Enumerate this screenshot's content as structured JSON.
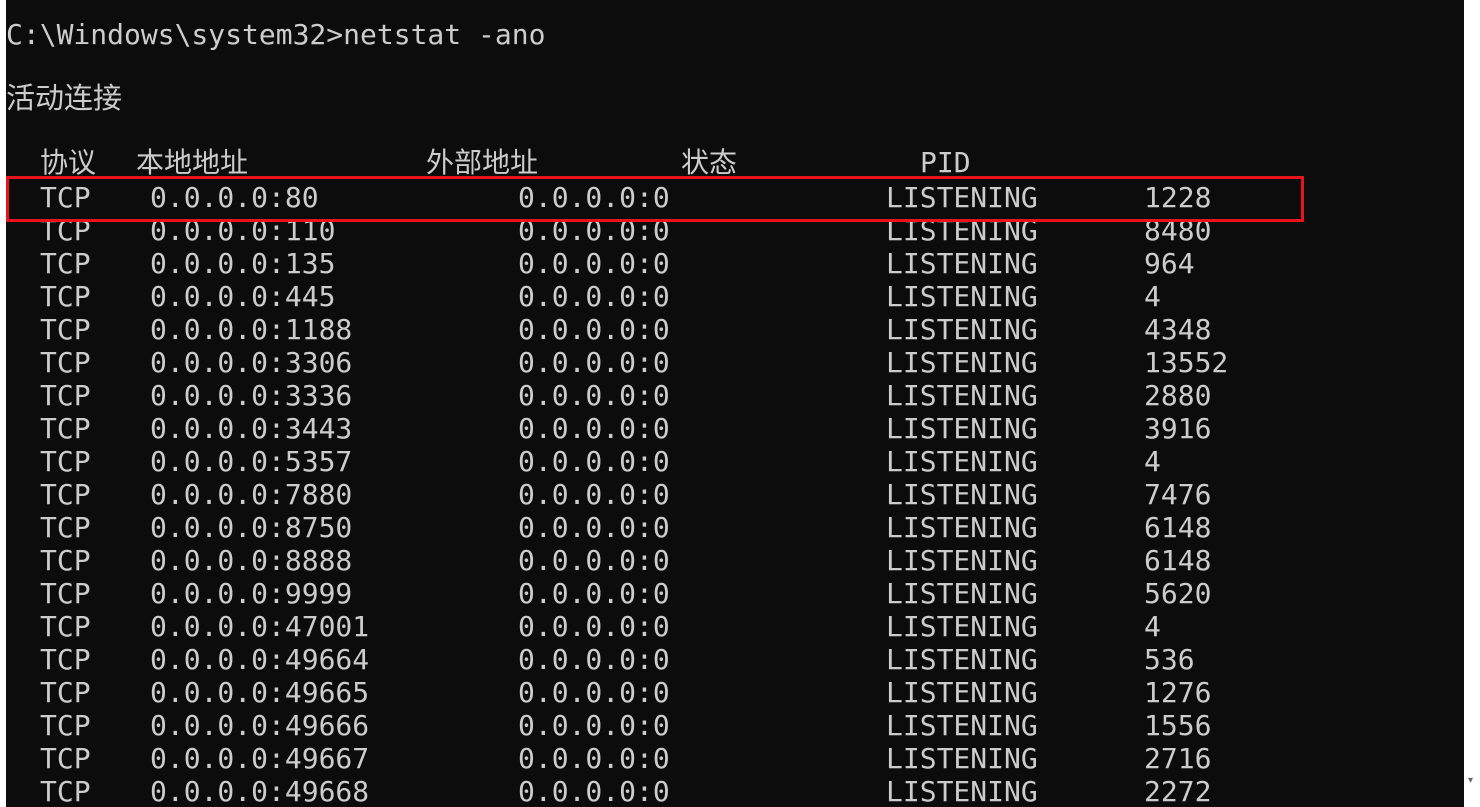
{
  "prompt": {
    "text": "C:\\Windows\\system32>netstat -ano"
  },
  "section_title": "活动连接",
  "table": {
    "headers": {
      "proto": "协议",
      "local": "本地地址",
      "foreign": "外部地址",
      "state": "状态",
      "pid": "PID"
    },
    "rows": [
      {
        "proto": "TCP",
        "local": "0.0.0.0:80",
        "foreign": "0.0.0.0:0",
        "state": "LISTENING",
        "pid": "1228"
      },
      {
        "proto": "TCP",
        "local": "0.0.0.0:110",
        "foreign": "0.0.0.0:0",
        "state": "LISTENING",
        "pid": "8480"
      },
      {
        "proto": "TCP",
        "local": "0.0.0.0:135",
        "foreign": "0.0.0.0:0",
        "state": "LISTENING",
        "pid": "964"
      },
      {
        "proto": "TCP",
        "local": "0.0.0.0:445",
        "foreign": "0.0.0.0:0",
        "state": "LISTENING",
        "pid": "4"
      },
      {
        "proto": "TCP",
        "local": "0.0.0.0:1188",
        "foreign": "0.0.0.0:0",
        "state": "LISTENING",
        "pid": "4348"
      },
      {
        "proto": "TCP",
        "local": "0.0.0.0:3306",
        "foreign": "0.0.0.0:0",
        "state": "LISTENING",
        "pid": "13552"
      },
      {
        "proto": "TCP",
        "local": "0.0.0.0:3336",
        "foreign": "0.0.0.0:0",
        "state": "LISTENING",
        "pid": "2880"
      },
      {
        "proto": "TCP",
        "local": "0.0.0.0:3443",
        "foreign": "0.0.0.0:0",
        "state": "LISTENING",
        "pid": "3916"
      },
      {
        "proto": "TCP",
        "local": "0.0.0.0:5357",
        "foreign": "0.0.0.0:0",
        "state": "LISTENING",
        "pid": "4"
      },
      {
        "proto": "TCP",
        "local": "0.0.0.0:7880",
        "foreign": "0.0.0.0:0",
        "state": "LISTENING",
        "pid": "7476"
      },
      {
        "proto": "TCP",
        "local": "0.0.0.0:8750",
        "foreign": "0.0.0.0:0",
        "state": "LISTENING",
        "pid": "6148"
      },
      {
        "proto": "TCP",
        "local": "0.0.0.0:8888",
        "foreign": "0.0.0.0:0",
        "state": "LISTENING",
        "pid": "6148"
      },
      {
        "proto": "TCP",
        "local": "0.0.0.0:9999",
        "foreign": "0.0.0.0:0",
        "state": "LISTENING",
        "pid": "5620"
      },
      {
        "proto": "TCP",
        "local": "0.0.0.0:47001",
        "foreign": "0.0.0.0:0",
        "state": "LISTENING",
        "pid": "4"
      },
      {
        "proto": "TCP",
        "local": "0.0.0.0:49664",
        "foreign": "0.0.0.0:0",
        "state": "LISTENING",
        "pid": "536"
      },
      {
        "proto": "TCP",
        "local": "0.0.0.0:49665",
        "foreign": "0.0.0.0:0",
        "state": "LISTENING",
        "pid": "1276"
      },
      {
        "proto": "TCP",
        "local": "0.0.0.0:49666",
        "foreign": "0.0.0.0:0",
        "state": "LISTENING",
        "pid": "1556"
      },
      {
        "proto": "TCP",
        "local": "0.0.0.0:49667",
        "foreign": "0.0.0.0:0",
        "state": "LISTENING",
        "pid": "2716"
      },
      {
        "proto": "TCP",
        "local": "0.0.0.0:49668",
        "foreign": "0.0.0.0:0",
        "state": "LISTENING",
        "pid": "2272"
      }
    ]
  },
  "highlight": {
    "color": "#e8141c",
    "row_index": 0
  },
  "colors": {
    "background": "#0c0c0c",
    "text": "#cccccc"
  },
  "icons": {
    "scroll_down": "scroll-down-arrow-icon"
  }
}
